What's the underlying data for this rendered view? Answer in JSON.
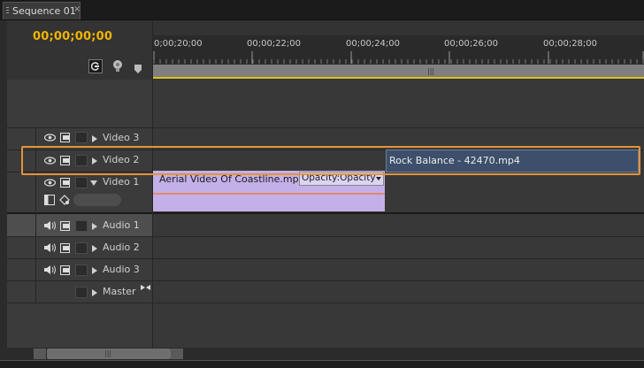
{
  "tab": {
    "title": "Sequence 01",
    "close": "×"
  },
  "timecode": "00;00;00;00",
  "ruler": {
    "labels": [
      "0;00;20;00",
      "00;00;22;00",
      "00;00;24;00",
      "00;00;26;00",
      "00;00;28;00"
    ]
  },
  "icons": {
    "snap": "snap-icon",
    "marker": "marker-icon",
    "flag": "flag-icon"
  },
  "tracks": {
    "video3": "Video 3",
    "video2": "Video 2",
    "video1": "Video 1",
    "audio1": "Audio 1",
    "audio2": "Audio 2",
    "audio3": "Audio 3",
    "master": "Master"
  },
  "clips": {
    "video1_name": "Aerial Video Of Coastline.mp4",
    "video1_effect": "Opacity:Opacity",
    "video2_name": "Rock Balance - 42470.mp4"
  },
  "colors": {
    "timecode": "#f2b400",
    "video_clip": "#c4b0e8",
    "selected_clip": "#3d4f6b",
    "highlight": "#e4933a"
  }
}
